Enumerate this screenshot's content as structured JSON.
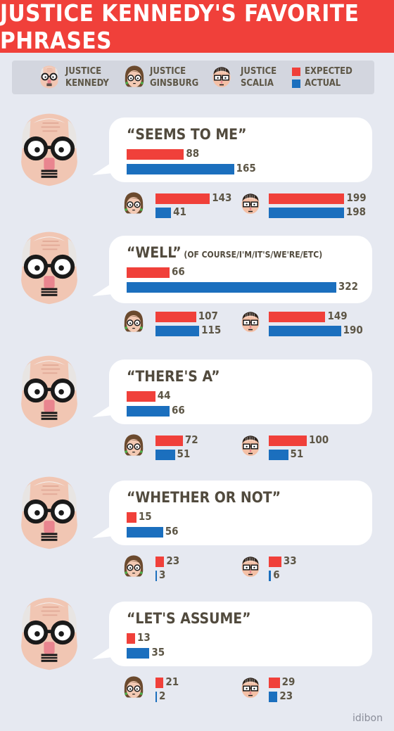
{
  "title": "JUSTICE KENNEDY'S FAVORITE PHRASES",
  "legend": {
    "kennedy": [
      "JUSTICE",
      "KENNEDY"
    ],
    "ginsburg": [
      "JUSTICE",
      "GINSBURG"
    ],
    "scalia": [
      "JUSTICE",
      "SCALIA"
    ],
    "expected": "EXPECTED",
    "actual": "ACTUAL"
  },
  "colors": {
    "expected": "#f0403a",
    "actual": "#1b6fbe",
    "background": "#e6e9f1"
  },
  "credit": "idibon",
  "chart_data": {
    "type": "bar",
    "series": [
      {
        "name": "EXPECTED"
      },
      {
        "name": "ACTUAL"
      }
    ],
    "phrases": [
      {
        "phrase": "“SEEMS TO ME”",
        "sub": "",
        "kennedy": {
          "expected": 88,
          "actual": 165
        },
        "ginsburg": {
          "expected": 143,
          "actual": 41
        },
        "scalia": {
          "expected": 199,
          "actual": 198
        }
      },
      {
        "phrase": "“WELL”",
        "sub": "(OF COURSE/I'M/IT'S/WE'RE/ETC)",
        "kennedy": {
          "expected": 66,
          "actual": 322
        },
        "ginsburg": {
          "expected": 107,
          "actual": 115
        },
        "scalia": {
          "expected": 149,
          "actual": 190
        }
      },
      {
        "phrase": "“THERE'S A”",
        "sub": "",
        "kennedy": {
          "expected": 44,
          "actual": 66
        },
        "ginsburg": {
          "expected": 72,
          "actual": 51
        },
        "scalia": {
          "expected": 100,
          "actual": 51
        }
      },
      {
        "phrase": "“WHETHER OR NOT”",
        "sub": "",
        "kennedy": {
          "expected": 15,
          "actual": 56
        },
        "ginsburg": {
          "expected": 23,
          "actual": 3
        },
        "scalia": {
          "expected": 33,
          "actual": 6
        }
      },
      {
        "phrase": "“LET'S ASSUME”",
        "sub": "",
        "kennedy": {
          "expected": 13,
          "actual": 35
        },
        "ginsburg": {
          "expected": 21,
          "actual": 2
        },
        "scalia": {
          "expected": 29,
          "actual": 23
        }
      }
    ]
  }
}
